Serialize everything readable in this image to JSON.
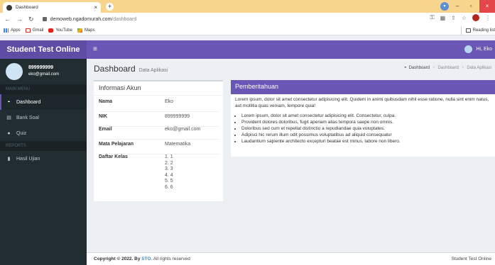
{
  "browser": {
    "tab_title": "Dashboard",
    "tab_close": "×",
    "newtab": "+",
    "win_min": "–",
    "win_max": "▫",
    "win_close": "×",
    "url_domain": "demoweb.ngadomurah.com",
    "url_path": "/dashboard",
    "bookmarks": [
      "Apps",
      "Gmail",
      "YouTube",
      "Maps"
    ],
    "reading_list": "Reading list"
  },
  "app": {
    "brand": "Student Test Online",
    "menu_icon": "≡",
    "greeting": "Hi, Eko"
  },
  "sidebar": {
    "user_name": "899999999",
    "user_email": "eko@gmail.com",
    "main_header": "MAIN MENU",
    "reports_header": "REPORTS",
    "items": [
      {
        "label": "Dashboard",
        "icon": "dashboard-icon",
        "glyph": "◓"
      },
      {
        "label": "Bank Soal",
        "icon": "bank-soal-icon",
        "glyph": "▤"
      },
      {
        "label": "Quiz",
        "icon": "quiz-icon",
        "glyph": "●"
      },
      {
        "label": "Hasil Ujian",
        "icon": "report-icon",
        "glyph": "▮"
      }
    ]
  },
  "page": {
    "title": "Dashboard",
    "subtitle": "Data Aplikasi",
    "breadcrumb": [
      "Dashboard",
      "Dashboard",
      "Data Aplikasi"
    ],
    "breadcrumb_home_glyph": "◓",
    "breadcrumb_sep": ">"
  },
  "info": {
    "heading": "Informasi Akun",
    "nama_label": "Nama",
    "nama_value": "Eko",
    "nik_label": "NIK",
    "nik_value": "899999999",
    "email_label": "Email",
    "email_value": "eko@gmail.com",
    "mapel_label": "Mata Pelajaran",
    "mapel_value": "Matematika",
    "kelas_label": "Daftar Kelas",
    "kelas": [
      "1. 1",
      "2. 2",
      "3. 3",
      "4. 4",
      "5. 5",
      "6. 6"
    ]
  },
  "notif": {
    "heading": "Pemberitahuan",
    "paragraph": "Lorem ipsum, dolor sit amet consectetur adipisicing elit. Quidem in animi quibusdam nihil esse ratione, nulla sint enim natus, aut mollitia quas veniam, tempore quia!",
    "items": [
      "Lorem ipsum, dolor sit amet consectetur adipisicing elit. Consectetur, culpa.",
      "Provident dolores doloribus, fugit aperiam alias tempora saepe non omnis.",
      "Doloribus sed cum et repellat distinctio a repudiandae quia voluptates.",
      "Adipisci hic rerum illum odit possimus voluptatibus ad aliquid consequatur",
      "Laudantium sapiente architecto excepturi beatae est minus, labore non libero."
    ]
  },
  "footer": {
    "copyright": "Copyright © 2022. By",
    "brand": "STO.",
    "rights": "All rights reserved",
    "right": "Student Test Online"
  },
  "colors": {
    "header_purple": "#6a56b4",
    "brand_purple": "#5f4ca4",
    "sidebar_dark": "#222d32",
    "tab_yellow": "#f7d58c"
  }
}
